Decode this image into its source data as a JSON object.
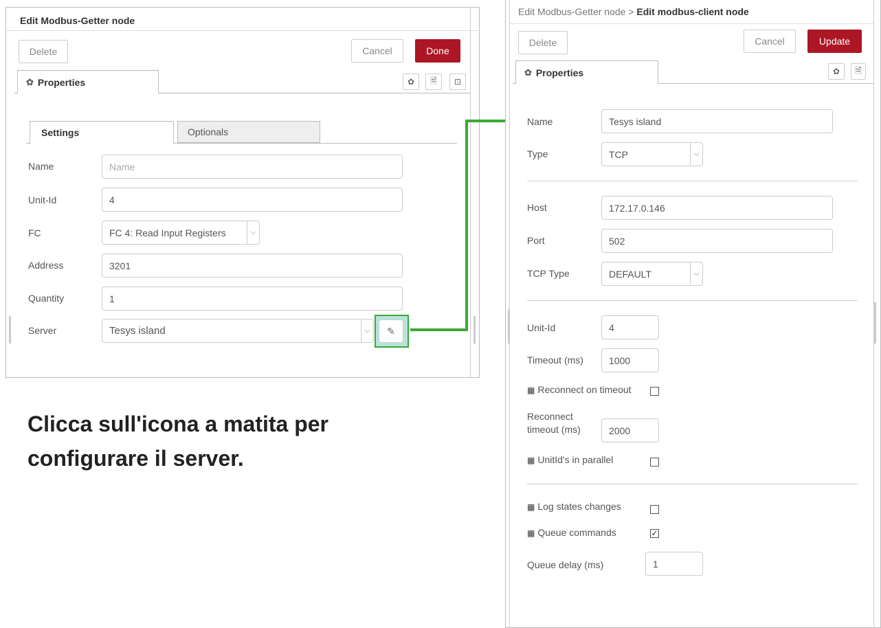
{
  "getter": {
    "title": "Edit Modbus-Getter node",
    "buttons": {
      "delete": "Delete",
      "cancel": "Cancel",
      "done": "Done"
    },
    "properties_tab": "Properties",
    "tabs": [
      "Settings",
      "Optionals"
    ],
    "fields": {
      "name": {
        "label": "Name",
        "placeholder": "Name"
      },
      "unit_id": {
        "label": "Unit-Id",
        "value": "4"
      },
      "fc": {
        "label": "FC",
        "value": "FC 4: Read Input Registers"
      },
      "address": {
        "label": "Address",
        "value": "3201"
      },
      "quantity": {
        "label": "Quantity",
        "value": "1"
      },
      "server": {
        "label": "Server",
        "value": "Tesys island"
      }
    }
  },
  "caption": "Clicca sull'icona a matita per configurare il server.",
  "client": {
    "breadcrumb_prefix": "Edit Modbus-Getter node >",
    "breadcrumb_current": "Edit modbus-client node",
    "buttons": {
      "delete": "Delete",
      "cancel": "Cancel",
      "update": "Update"
    },
    "properties_tab": "Properties",
    "fields": {
      "name": {
        "label": "Name",
        "value": "Tesys island"
      },
      "type": {
        "label": "Type",
        "value": "TCP"
      },
      "host": {
        "label": "Host",
        "value": "172.17.0.146"
      },
      "port": {
        "label": "Port",
        "value": "502"
      },
      "tcp_type": {
        "label": "TCP Type",
        "value": "DEFAULT"
      },
      "unit_id": {
        "label": "Unit-Id",
        "value": "4"
      },
      "timeout": {
        "label": "Timeout (ms)",
        "value": "1000"
      },
      "reconnect_on_timeout": {
        "label": "Reconnect on timeout",
        "checked": false
      },
      "reconnect_timeout_l1": "Reconnect",
      "reconnect_timeout_l2": "timeout (ms)",
      "reconnect_timeout": {
        "value": "2000"
      },
      "unitids_parallel": {
        "label": "UnitId's in parallel",
        "checked": false
      },
      "log_states": {
        "label": "Log states changes",
        "checked": false
      },
      "queue_commands": {
        "label": "Queue commands",
        "checked": true
      },
      "queue_delay": {
        "label": "Queue delay (ms)",
        "value": "1"
      }
    }
  },
  "colors": {
    "primary": "#ad1625",
    "highlight_green": "#3aa935",
    "highlight_fill": "#b8e3dc"
  },
  "icons": [
    "gear-icon",
    "document-icon",
    "expand-icon",
    "pencil-icon",
    "grid-icon",
    "checkmark-icon",
    "chevron-down-icon"
  ]
}
